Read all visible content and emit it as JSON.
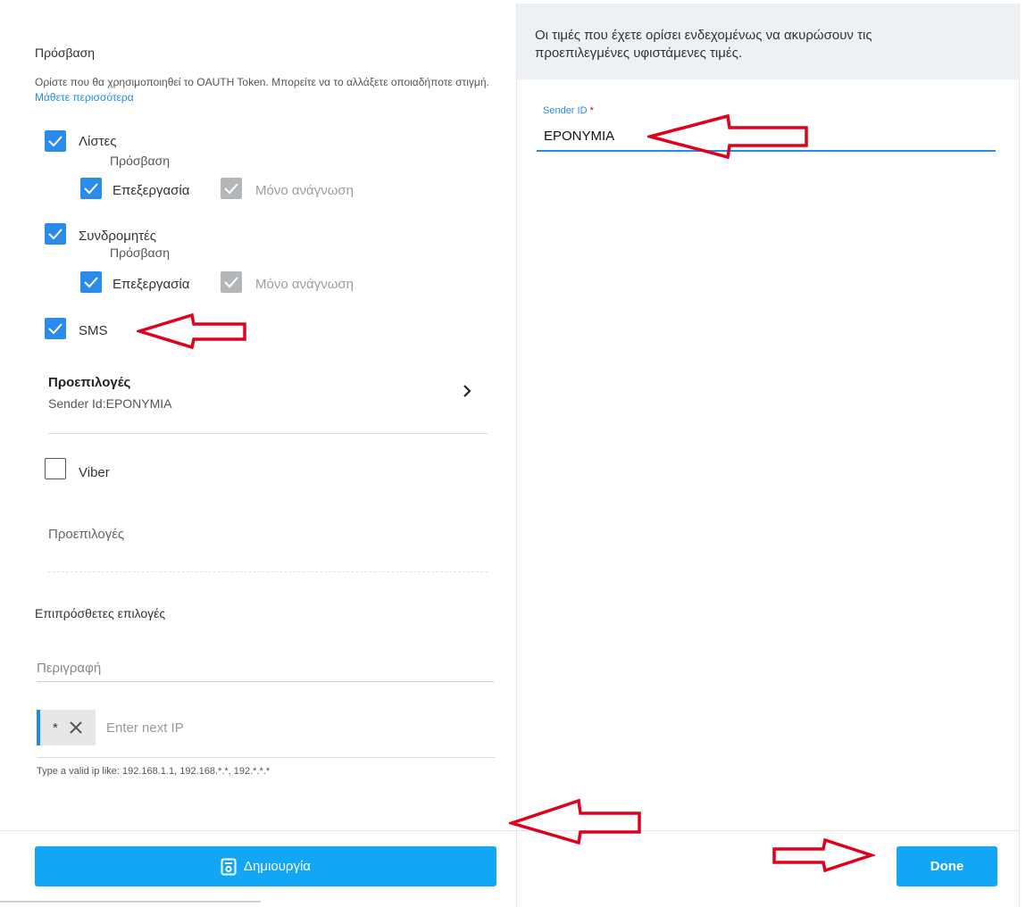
{
  "access": {
    "title": "Πρόσβαση",
    "help_text": "Ορίστε που θα χρησιμοποιηθεί το OAUTH Token. Μπορείτε να το αλλάξετε οποιαδήποτε στιγμή.",
    "help_link": "Μάθετε περισσότερα",
    "lists": {
      "label": "Λίστες",
      "checked": true,
      "sub_label": "Πρόσβαση",
      "edit": "Επεξεργασία",
      "readonly": "Μόνο ανάγνωση"
    },
    "subscribers": {
      "label": "Συνδρομητές",
      "checked": true,
      "sub_label": "Πρόσβαση",
      "edit": "Επεξεργασία",
      "readonly": "Μόνο ανάγνωση"
    },
    "sms": {
      "label": "SMS",
      "checked": true,
      "defaults_title": "Προεπιλογές",
      "defaults_value": "Sender Id:EPONYMIA"
    },
    "viber": {
      "label": "Viber",
      "checked": false,
      "defaults_title": "Προεπιλογές"
    }
  },
  "extra": {
    "title": "Επιπρόσθετες επιλογές",
    "description_placeholder": "Περιγραφή",
    "ip_chip": "*",
    "ip_placeholder": "Enter next IP",
    "ip_hint": "Type a valid ip like: 192.168.1.1, 192.168.*.*, 192.*.*.*"
  },
  "buttons": {
    "create": "Δημιουργία",
    "done": "Done"
  },
  "right_panel": {
    "notice": "Οι τιμές που έχετε ορίσει ενδεχομένως να ακυρώσουν τις προεπιλεγμένες υφιστάμενες τιμές.",
    "sender_label": "Sender ID",
    "sender_required": "*",
    "sender_value": "EPONYMIA"
  },
  "colors": {
    "accent": "#13a6f4",
    "checkbox": "#2a8bea",
    "annotation": "#e0001b"
  }
}
